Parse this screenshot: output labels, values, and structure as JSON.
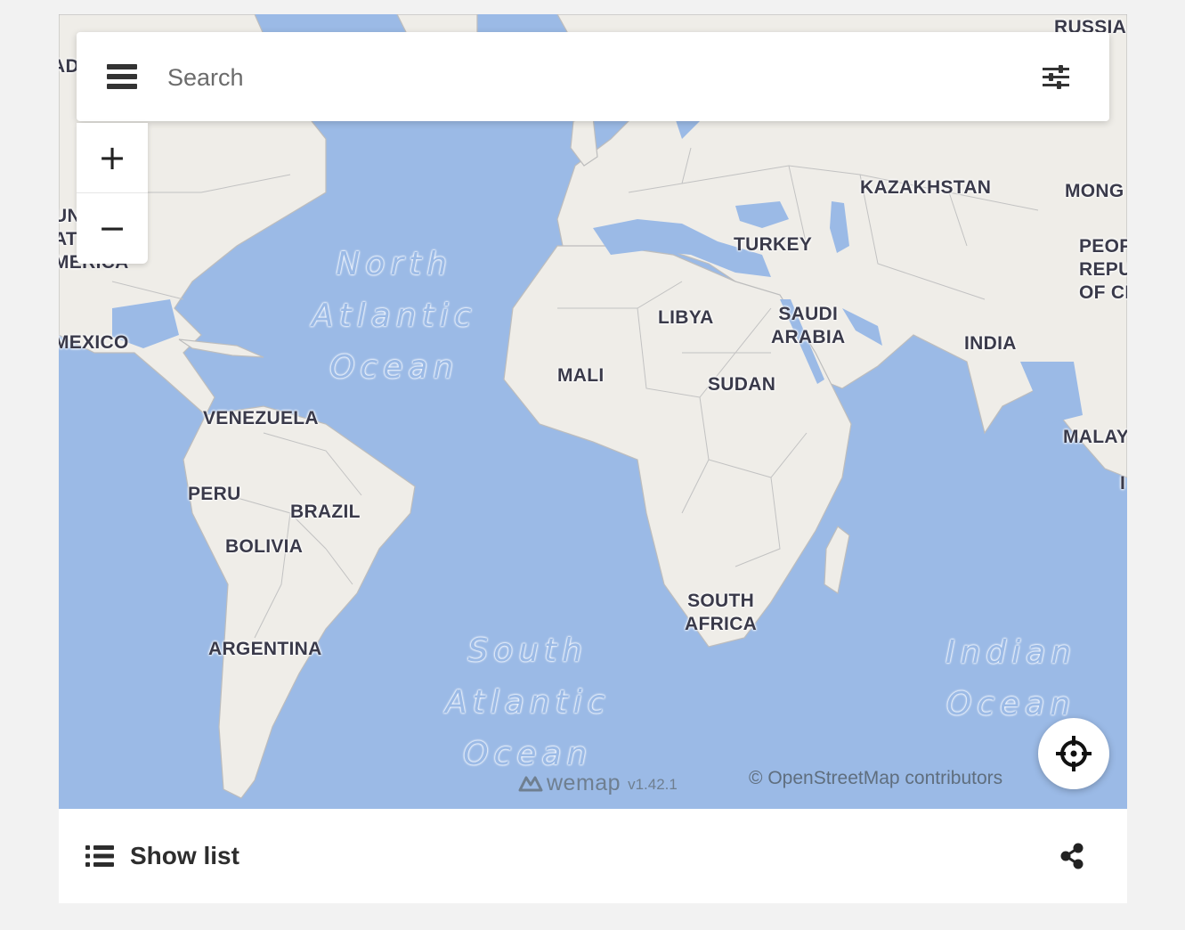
{
  "search": {
    "placeholder": "Search"
  },
  "map": {
    "countries": [
      {
        "id": "russia",
        "label": "RUSSIA"
      },
      {
        "id": "canada-partial",
        "label": "ADA"
      },
      {
        "id": "kazakhstan",
        "label": "KAZAKHSTAN"
      },
      {
        "id": "mongolia-partial",
        "label": "MONG"
      },
      {
        "id": "turkey",
        "label": "TURKEY"
      },
      {
        "id": "china-partial",
        "label": "PEOP\nREPU\nOF CH"
      },
      {
        "id": "usa-partial",
        "label": "UN\nAT\nMERICA"
      },
      {
        "id": "libya",
        "label": "LIBYA"
      },
      {
        "id": "saudi-arabia",
        "label": "SAUDI\nARABIA"
      },
      {
        "id": "mexico",
        "label": "MEXICO"
      },
      {
        "id": "india",
        "label": "INDIA"
      },
      {
        "id": "mali",
        "label": "MALI"
      },
      {
        "id": "sudan",
        "label": "SUDAN"
      },
      {
        "id": "venezuela",
        "label": "VENEZUELA"
      },
      {
        "id": "malaysia-partial",
        "label": "MALAY"
      },
      {
        "id": "indonesia-partial",
        "label": "I"
      },
      {
        "id": "peru",
        "label": "PERU"
      },
      {
        "id": "brazil",
        "label": "BRAZIL"
      },
      {
        "id": "bolivia",
        "label": "BOLIVIA"
      },
      {
        "id": "south-africa",
        "label": "SOUTH\nAFRICA"
      },
      {
        "id": "argentina",
        "label": "ARGENTINA"
      }
    ],
    "oceans": [
      {
        "id": "north-atlantic",
        "label": "North\nAtlantic\nOcean"
      },
      {
        "id": "south-atlantic",
        "label": "South\nAtlantic\nOcean"
      },
      {
        "id": "indian",
        "label": "Indian\nOcean"
      }
    ],
    "colors": {
      "water": "#9bbae6",
      "land": "#efede8",
      "border": "#b8b8b8"
    }
  },
  "zoom": {
    "in": "+",
    "out": "−"
  },
  "branding": {
    "name": "wemap",
    "version": "v1.42.1"
  },
  "attribution": {
    "symbol": "©",
    "link": "OpenStreetMap contributors"
  },
  "footer": {
    "show_list_label": "Show list"
  },
  "icons": {
    "menu": "hamburger-icon",
    "filter": "sliders-icon",
    "locate": "crosshair-icon",
    "list": "list-icon",
    "share": "share-icon",
    "brand": "wemap-logo"
  }
}
